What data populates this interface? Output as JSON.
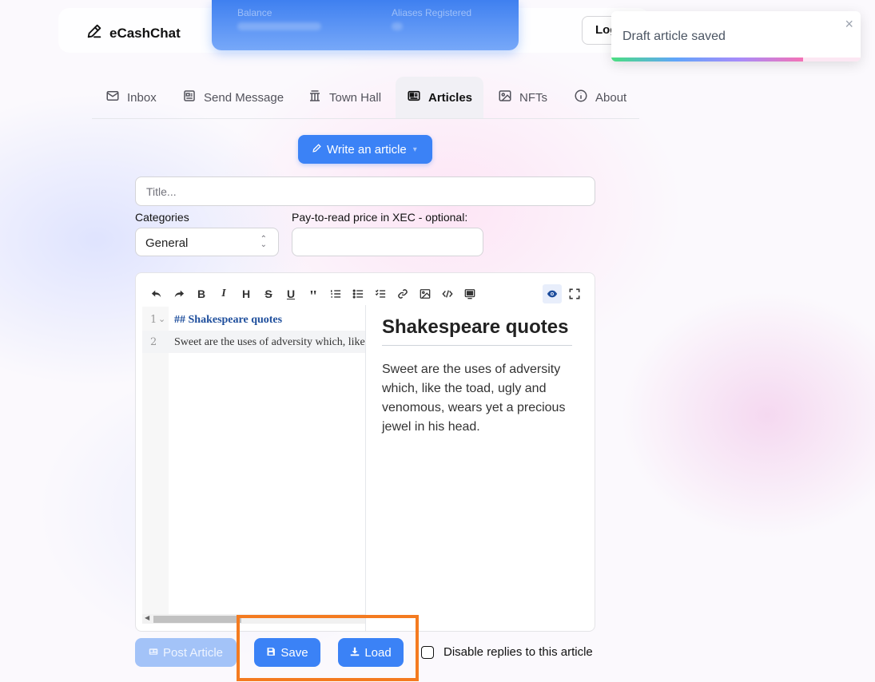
{
  "app": {
    "brand": "eCashChat"
  },
  "header": {
    "balance_label": "Balance",
    "aliases_label": "Aliases Registered",
    "login_label": "Login"
  },
  "toast": {
    "message": "Draft article saved",
    "close_icon": "×",
    "progress": 0.77
  },
  "tabs": [
    {
      "label": "Inbox",
      "icon": "mail-icon"
    },
    {
      "label": "Send Message",
      "icon": "newspaper-icon"
    },
    {
      "label": "Town Hall",
      "icon": "town-hall-icon"
    },
    {
      "label": "Articles",
      "icon": "reader-icon",
      "active": true
    },
    {
      "label": "NFTs",
      "icon": "image-icon"
    },
    {
      "label": "About",
      "icon": "info-icon"
    }
  ],
  "write_button": {
    "label": "Write an article"
  },
  "form": {
    "title_placeholder": "Title...",
    "categories_label": "Categories",
    "category_value": "General",
    "price_label": "Pay-to-read price in XEC - optional:",
    "price_value": ""
  },
  "editor": {
    "lines": [
      {
        "number": "1",
        "text": "## Shakespeare quotes"
      },
      {
        "number": "2",
        "text": "Sweet are the uses of adversity which, like"
      }
    ],
    "fold_marker": "⌄",
    "toolbar": [
      "undo-icon",
      "redo-icon",
      "bold-icon",
      "italic-icon",
      "heading-icon",
      "strikethrough-icon",
      "underline-icon",
      "quote-icon",
      "ordered-list-icon",
      "unordered-list-icon",
      "checklist-icon",
      "link-icon",
      "image-icon",
      "code-icon",
      "table-icon",
      "preview-icon",
      "fullscreen-icon"
    ]
  },
  "preview": {
    "heading": "Shakespeare quotes",
    "paragraph": "Sweet are the uses of adversity which, like the toad, ugly and venomous, wears yet a precious jewel in his head."
  },
  "actions": {
    "post_label": "Post Article",
    "save_label": "Save",
    "load_label": "Load",
    "disable_replies_label": "Disable replies to this article",
    "disable_replies_checked": false
  },
  "colors": {
    "accent": "#3b82f6",
    "highlight": "#f47b20"
  }
}
